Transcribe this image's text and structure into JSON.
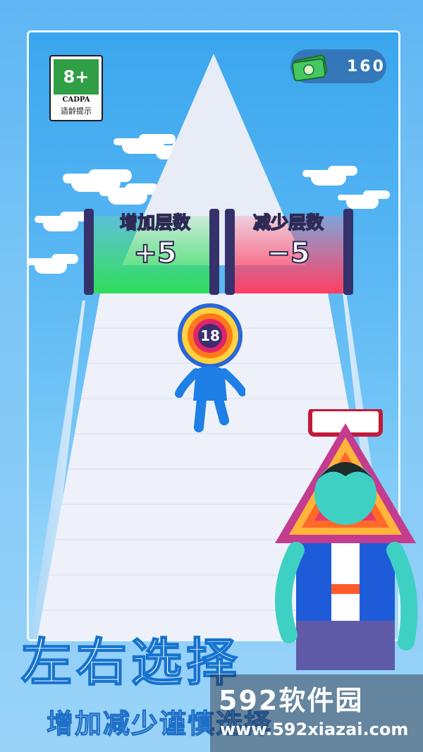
{
  "age_badge": {
    "rating": "8+",
    "org": "CADPA",
    "note": "适龄提示"
  },
  "currency": {
    "icon": "cash-stack-icon",
    "value": "160"
  },
  "gates": {
    "left": {
      "title": "增加层数",
      "value": "+5",
      "color": "#2fdc5c"
    },
    "right": {
      "title": "减少层数",
      "value": "−5",
      "color": "#ff3e63"
    }
  },
  "player": {
    "layer_count": "18",
    "color": "#1e7fe6"
  },
  "caption": {
    "title": "左右选择",
    "subtitle": "增加减少谨慎选择"
  },
  "watermark": {
    "brand": "592软件园",
    "url": "www.592xiazai.com"
  }
}
